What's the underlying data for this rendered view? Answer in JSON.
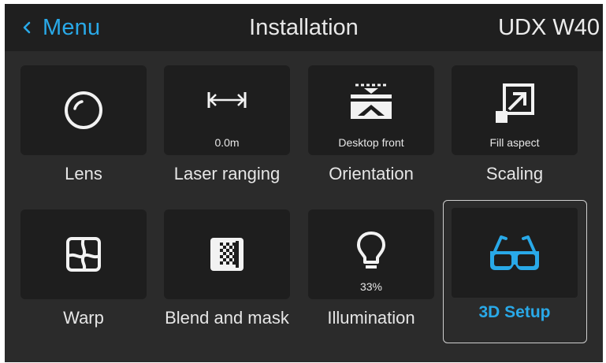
{
  "header": {
    "back_label": "Menu",
    "title": "Installation",
    "model": "UDX W40"
  },
  "tiles": [
    {
      "label": "Lens",
      "value": "",
      "icon": "lens-circle-icon"
    },
    {
      "label": "Laser ranging",
      "value": "0.0m",
      "icon": "laser-ranging-arrows-icon"
    },
    {
      "label": "Orientation",
      "value": "Desktop front",
      "icon": "orientation-icon"
    },
    {
      "label": "Scaling",
      "value": "Fill aspect",
      "icon": "scaling-icon"
    },
    {
      "label": "Warp",
      "value": "",
      "icon": "warp-icon"
    },
    {
      "label": "Blend and mask",
      "value": "",
      "icon": "blend-mask-icon"
    },
    {
      "label": "Illumination",
      "value": "33%",
      "icon": "lightbulb-icon"
    },
    {
      "label": "3D Setup",
      "value": "",
      "icon": "3d-glasses-icon",
      "selected": true
    }
  ],
  "colors": {
    "accent": "#29a9e8",
    "background": "#2b2b2b",
    "tile": "#1e1e1e",
    "header": "#1f1f1f",
    "text": "#e6e6e6"
  }
}
